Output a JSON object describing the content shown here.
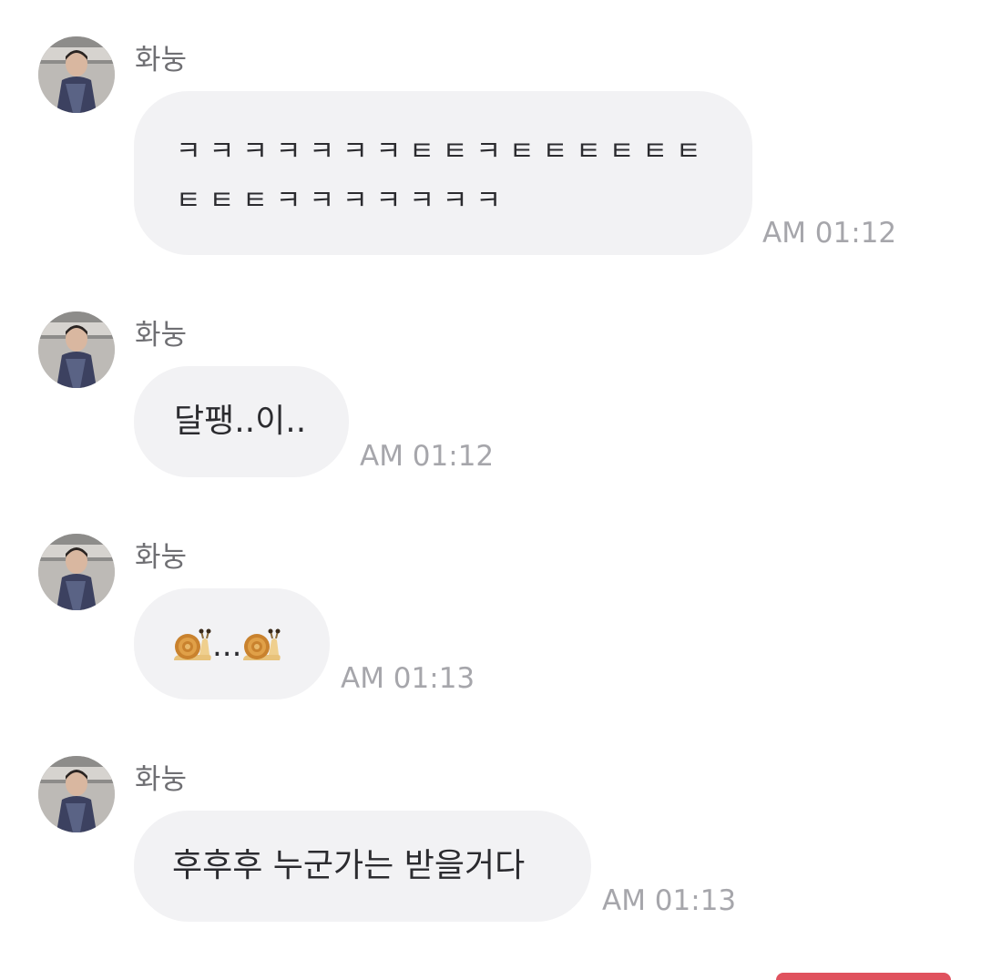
{
  "messages": [
    {
      "sender": "화눙",
      "lines": [
        "ㅋㅋㅋㅋㅋㅋㅋㅌㅌㅋㅌㅌㅌㅌㅌㅌ",
        "ㅌㅌㅌㅋㅋㅋㅋㅋㅋㅋ"
      ],
      "time": "AM 01:12"
    },
    {
      "sender": "화눙",
      "text": "달팽..이..",
      "time": "AM 01:12"
    },
    {
      "sender": "화눙",
      "emoji": "snail-icon",
      "text": "...",
      "time": "AM 01:13"
    },
    {
      "sender": "화눙",
      "text": "후후후 누군가는 받을거다",
      "time": "AM 01:13"
    }
  ],
  "colors": {
    "bubble": "#f2f2f4",
    "time": "#a6a6ab",
    "sender": "#6f6f73",
    "accent": "#e0525e"
  }
}
